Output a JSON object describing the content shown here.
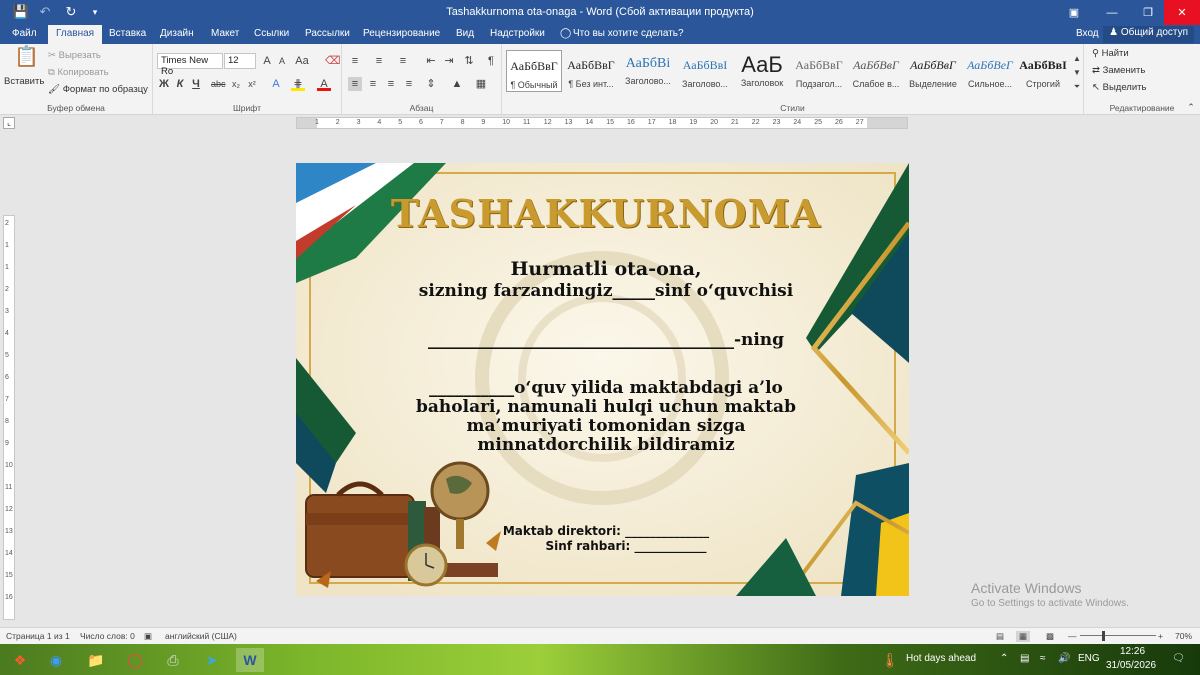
{
  "window": {
    "title": "Tashakkurnoma ota-onaga - Word (Сбой активации продукта)",
    "controls": [
      "ribbon-options",
      "minimize",
      "restore",
      "close"
    ]
  },
  "quick_access": {
    "icons": [
      "save-icon",
      "undo-icon",
      "redo-icon",
      "customize-icon"
    ]
  },
  "menu": {
    "tabs": [
      "Файл",
      "Главная",
      "Вставка",
      "Дизайн",
      "Макет",
      "Ссылки",
      "Рассылки",
      "Рецензирование",
      "Вид",
      "Надстройки"
    ],
    "active": "Главная",
    "tell_me": "Что вы хотите сделать?",
    "signin": "Вход",
    "share": "Общий доступ"
  },
  "ribbon": {
    "clipboard": {
      "label": "Буфер обмена",
      "paste": "Вставить",
      "cut": "Вырезать",
      "copy": "Копировать",
      "format_painter": "Формат по образцу"
    },
    "font": {
      "label": "Шрифт",
      "family": "Times New Ro",
      "size": "12"
    },
    "paragraph": {
      "label": "Абзац"
    },
    "styles": {
      "label": "Стили",
      "items": [
        {
          "sample": "АаБбВвГ",
          "name": "¶ Обычный"
        },
        {
          "sample": "АаБбВвГ",
          "name": "¶ Без инт..."
        },
        {
          "sample": "АаБбВі",
          "name": "Заголово..."
        },
        {
          "sample": "АаБбВвІ",
          "name": "Заголово..."
        },
        {
          "sample": "АаБ",
          "name": "Заголовок"
        },
        {
          "sample": "АаБбВвГ",
          "name": "Подзагол..."
        },
        {
          "sample": "АаБбВвГ",
          "name": "Слабое в..."
        },
        {
          "sample": "АаБбВвГ",
          "name": "Выделение"
        },
        {
          "sample": "АаБбВеГ",
          "name": "Сильное..."
        },
        {
          "sample": "АаБбВвІ",
          "name": "Строгий"
        }
      ]
    },
    "editing": {
      "label": "Редактирование",
      "find": "Найти",
      "replace": "Заменить",
      "select": "Выделить"
    }
  },
  "ruler": {
    "h_ticks": [
      "1",
      "2",
      "3",
      "4",
      "5",
      "6",
      "7",
      "8",
      "9",
      "10",
      "11",
      "12",
      "13",
      "14",
      "15",
      "16",
      "17",
      "18",
      "19",
      "20",
      "21",
      "22",
      "23",
      "24",
      "25",
      "26",
      "27"
    ],
    "v_ticks": [
      "2",
      "1",
      "1",
      "2",
      "3",
      "4",
      "5",
      "6",
      "7",
      "8",
      "9",
      "10",
      "11",
      "12",
      "13",
      "14",
      "15",
      "16"
    ]
  },
  "certificate": {
    "title": "TASHAKKURNOMA",
    "line1": "Hurmatli ota-ona,",
    "line2": "sizning farzandingiz_____sinf o‘quvchisi",
    "line3": "____________________________________-ning",
    "line4": "__________o‘quv yilida maktabdagi a’lo",
    "line5": "baholari, namunali hulqi uchun maktab",
    "line6": "ma’muriyati tomonidan sizga",
    "line7": "minnatdorchilik bildiramiz",
    "sign1": "Maktab direktori: ______________",
    "sign2": "Sinf rahbari: ____________"
  },
  "watermark": {
    "line1": "Activate Windows",
    "line2": "Go to Settings to activate Windows."
  },
  "status": {
    "page": "Страница 1 из 1",
    "words": "Число слов: 0",
    "language": "английский (США)",
    "zoom": "70%"
  },
  "taskbar": {
    "weather": "Hot days ahead",
    "lang": "ENG",
    "time": "12:26",
    "date": "31/05/2026"
  },
  "colors": {
    "titlebar": "#2b579a",
    "gold": "#c99a2e",
    "green": "#1b6b3a",
    "close": "#e81123"
  }
}
